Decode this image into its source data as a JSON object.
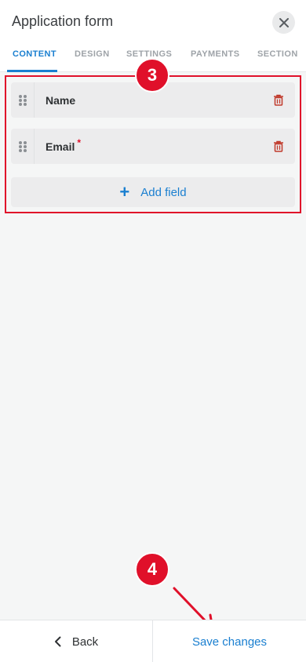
{
  "header": {
    "title": "Application form",
    "close_icon": "close-icon"
  },
  "tabs": [
    {
      "label": "CONTENT",
      "active": true
    },
    {
      "label": "DESIGN",
      "active": false
    },
    {
      "label": "SETTINGS",
      "active": false
    },
    {
      "label": "PAYMENTS",
      "active": false
    },
    {
      "label": "SECTION",
      "active": false
    }
  ],
  "fields": [
    {
      "label": "Name",
      "required": false
    },
    {
      "label": "Email",
      "required": true,
      "required_mark": "*"
    }
  ],
  "add_field": {
    "label": "Add field",
    "icon": "plus-icon"
  },
  "annotations": {
    "step3": "3",
    "step4": "4"
  },
  "footer": {
    "back_label": "Back",
    "save_label": "Save changes"
  },
  "colors": {
    "accent": "#1a7fd0",
    "annotation_red": "#e0102a",
    "trash": "#c0392b",
    "background": "#f5f6f6"
  }
}
